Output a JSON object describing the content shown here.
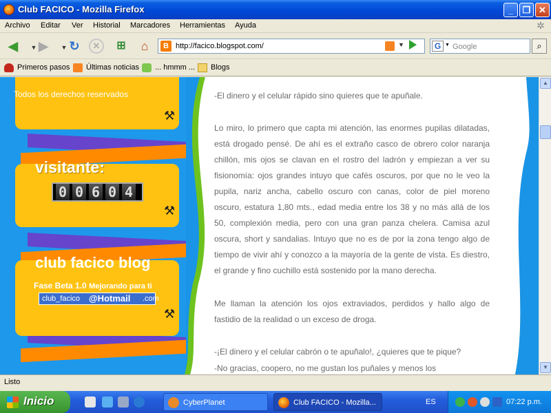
{
  "window": {
    "title": "Club FACICO - Mozilla Firefox"
  },
  "menu": [
    "Archivo",
    "Editar",
    "Ver",
    "Historial",
    "Marcadores",
    "Herramientas",
    "Ayuda"
  ],
  "address": {
    "url": "http://facico.blogspot.com/"
  },
  "search": {
    "placeholder": "Google"
  },
  "bookmarks": [
    "Primeros pasos",
    "Últimas noticias",
    "... hmmm ...",
    "Blogs"
  ],
  "sidebar": {
    "copyright": "Todos los derechos reservados",
    "visitor_title": "visitante:",
    "counter_digits": [
      "0",
      "0",
      "6",
      "0",
      "4"
    ],
    "club_title": "club facico blog",
    "beta_main": "Fase Beta 1.0",
    "beta_sub": "Mejorando para ti",
    "mail_user": "club_facico",
    "mail_domain": "@Hotmail",
    "mail_tld": ".com"
  },
  "post": {
    "p1": "-El dinero y el celular rápido sino quieres que te apuñale.",
    "p2": "Lo miro, lo primero que capta mi atención, las enormes pupilas dilatadas, está drogado pensé. De ahí es el extraño casco de obrero color naranja chillón, mis ojos se clavan en el rostro del ladrón y empiezan a ver su fisionomía: ojos grandes intuyo que cafés oscuros, por que no le veo la pupila, nariz ancha, cabello oscuro con canas, color de piel moreno oscuro, estatura 1,80 mts., edad media entre los 38 y no más allá de los 50, complexión media, pero con una gran panza chelera. Camisa azul oscura, short y sandalias. Intuyo que no es de por la zona tengo algo de tiempo de vivir ahí y conozco a la mayoría de la gente de vista. Es diestro, el grande y fino cuchillo está sostenido por la mano derecha.",
    "p3": "Me llaman la atención los ojos extraviados, perdidos y hallo algo de fastidio de la realidad o un exceso de droga.",
    "p4": "-¡El dinero y el celular cabrón o te apuñalo!, ¿quieres que te pique?",
    "p5": "-No gracias, coopero, no me gustan los puñales y menos los"
  },
  "status": {
    "text": "Listo"
  },
  "taskbar": {
    "start": "Inicio",
    "tasks": [
      "CyberPlanet",
      "Club FACICO - Mozilla..."
    ],
    "lang": "ES",
    "clock": "07:22 p.m."
  },
  "icons": {
    "window_minimize": "minimize-icon",
    "window_maximize": "maximize-icon",
    "window_close": "close-icon",
    "back": "back-arrow-icon",
    "forward": "forward-arrow-icon",
    "reload": "reload-icon",
    "stop": "stop-icon",
    "home": "home-icon",
    "tools": "tools-icon"
  }
}
